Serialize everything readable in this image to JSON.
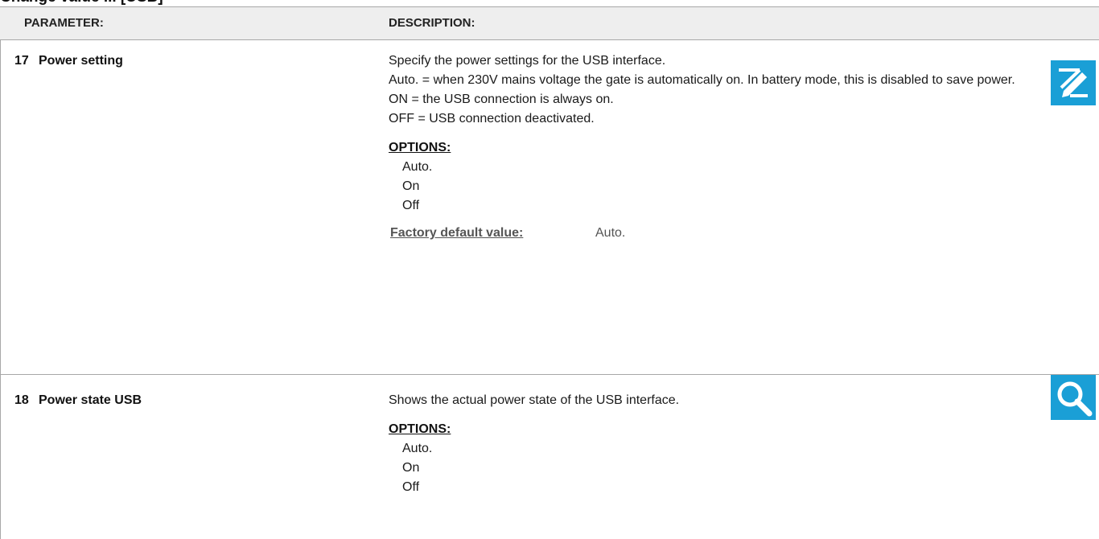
{
  "top_heading": "Change value ... [USB]",
  "header": {
    "parameter": "PARAMETER:",
    "description": "DESCRIPTION:"
  },
  "rows": [
    {
      "number": "17",
      "name": "Power setting",
      "icon": "edit-pencil-icon",
      "description_lines": [
        "Specify the power settings for the USB interface.",
        "Auto. = when 230V mains voltage the gate is automatically on. In battery mode, this is disabled to save power.",
        "ON = the USB connection is always on.",
        "OFF = USB connection deactivated."
      ],
      "options_title": "OPTIONS:",
      "options": [
        "Auto.",
        "On",
        "Off"
      ],
      "factory_label": "Factory default value:",
      "factory_value": "Auto."
    },
    {
      "number": "18",
      "name": "Power state USB",
      "icon": "magnifier-icon",
      "description_lines": [
        "Shows the actual power state of the USB interface."
      ],
      "options_title": "OPTIONS:",
      "options": [
        "Auto.",
        "On",
        "Off"
      ]
    }
  ],
  "colors": {
    "icon_bg": "#1a9fd6",
    "header_bg": "#eeeeee",
    "border": "#a8a8a8"
  }
}
